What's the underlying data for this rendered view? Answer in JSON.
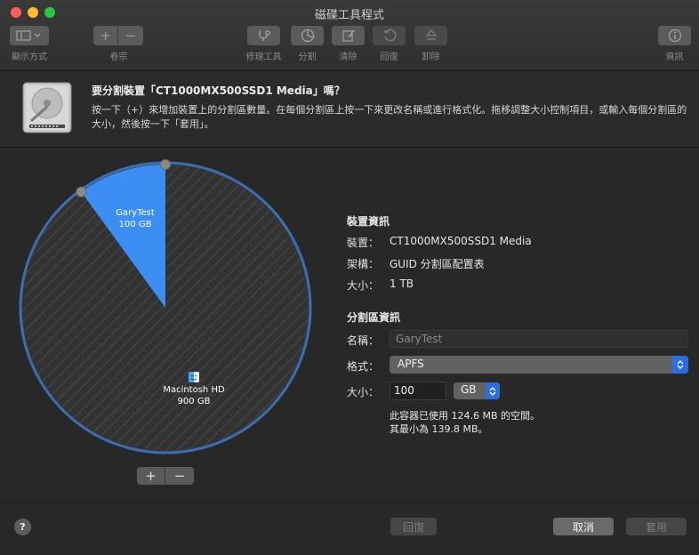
{
  "window": {
    "title": "磁碟工具程式"
  },
  "toolbar": {
    "view_label": "顯示方式",
    "volume_label": "卷宗",
    "volume_add": "+",
    "volume_remove": "−",
    "firstaid_label": "修理工具",
    "partition_label": "分割",
    "erase_label": "清除",
    "restore_label": "回復",
    "unmount_label": "卸除",
    "info_label": "資訊"
  },
  "header": {
    "title": "要分割裝置「CT1000MX500SSD1 Media」嗎？",
    "description": "按一下（+）來增加裝置上的分割區數量。在每個分割區上按一下來更改名稱或進行格式化。拖移調整大小控制項目，或輸入每個分割區的大小，然後按一下「套用」。"
  },
  "partitions": [
    {
      "name": "GaryTest",
      "size": "100 GB",
      "fraction": 0.1,
      "color": "#3d8ef2"
    },
    {
      "name": "Macintosh HD",
      "size": "900 GB",
      "fraction": 0.9,
      "color": "#343434"
    }
  ],
  "partition_controls": {
    "add": "+",
    "remove": "−"
  },
  "device_info": {
    "title": "裝置資訊",
    "device_key": "裝置：",
    "device_val": "CT1000MX500SSD1 Media",
    "scheme_key": "架構：",
    "scheme_val": "GUID 分割區配置表",
    "size_key": "大小：",
    "size_val": "1 TB"
  },
  "partition_info": {
    "title": "分割區資訊",
    "name_key": "名稱：",
    "name_value": "GaryTest",
    "format_key": "格式：",
    "format_value": "APFS",
    "size_key": "大小：",
    "size_value": "100",
    "size_unit": "GB",
    "used_note": "此容器已使用 124.6 MB 的空間。",
    "min_note": "其最小為 139.8 MB。"
  },
  "footer": {
    "help": "?",
    "revert": "回復",
    "cancel": "取消",
    "apply": "套用"
  },
  "colors": {
    "accent": "#2a6fe0",
    "pie_ring": "#3a6fb0"
  }
}
